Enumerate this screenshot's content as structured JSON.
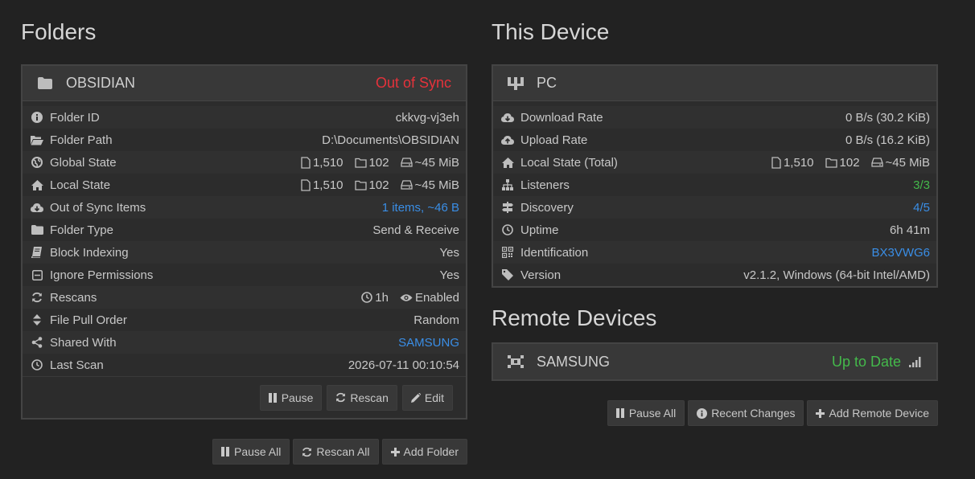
{
  "folders": {
    "heading": "Folders",
    "folder": {
      "name": "OBSIDIAN",
      "status": "Out of Sync",
      "rows": [
        {
          "icon": "info-icon",
          "label": "Folder ID",
          "value": "ckkvg-vj3eh"
        },
        {
          "icon": "folder-open-icon",
          "label": "Folder Path",
          "value": "D:\\Documents\\OBSIDIAN"
        },
        {
          "icon": "globe-icon",
          "label": "Global State",
          "files": "1,510",
          "dirs": "102",
          "size": "~45 MiB"
        },
        {
          "icon": "home-icon",
          "label": "Local State",
          "files": "1,510",
          "dirs": "102",
          "size": "~45 MiB"
        },
        {
          "icon": "cloud-download-icon",
          "label": "Out of Sync Items",
          "value": "1 items, ~46 B"
        },
        {
          "icon": "folder-icon",
          "label": "Folder Type",
          "value": "Send & Receive"
        },
        {
          "icon": "book-icon",
          "label": "Block Indexing",
          "value": "Yes"
        },
        {
          "icon": "square-icon",
          "label": "Ignore Permissions",
          "value": "Yes"
        },
        {
          "icon": "refresh-icon",
          "label": "Rescans",
          "interval": "1h",
          "watcher": "Enabled"
        },
        {
          "icon": "sort-icon",
          "label": "File Pull Order",
          "value": "Random"
        },
        {
          "icon": "share-icon",
          "label": "Shared With",
          "value": "SAMSUNG"
        },
        {
          "icon": "clock-icon",
          "label": "Last Scan",
          "value": "2026-07-11 00:10:54"
        }
      ],
      "buttons": {
        "pause": "Pause",
        "rescan": "Rescan",
        "edit": "Edit"
      }
    },
    "buttons": {
      "pause_all": "Pause All",
      "rescan_all": "Rescan All",
      "add_folder": "Add Folder"
    }
  },
  "this_device": {
    "heading": "This Device",
    "name": "PC",
    "rows": [
      {
        "icon": "cloud-download-icon",
        "label": "Download Rate",
        "value": "0 B/s (30.2 KiB)"
      },
      {
        "icon": "cloud-upload-icon",
        "label": "Upload Rate",
        "value": "0 B/s (16.2 KiB)"
      },
      {
        "icon": "home-icon",
        "label": "Local State (Total)",
        "files": "1,510",
        "dirs": "102",
        "size": "~45 MiB"
      },
      {
        "icon": "sitemap-icon",
        "label": "Listeners",
        "value": "3/3"
      },
      {
        "icon": "signpost-icon",
        "label": "Discovery",
        "value": "4/5"
      },
      {
        "icon": "clock-icon",
        "label": "Uptime",
        "value": "6h 41m"
      },
      {
        "icon": "qrcode-icon",
        "label": "Identification",
        "value": "BX3VWG6"
      },
      {
        "icon": "tag-icon",
        "label": "Version",
        "value": "v2.1.2, Windows (64-bit Intel/AMD)"
      }
    ]
  },
  "remote_devices": {
    "heading": "Remote Devices",
    "device": {
      "name": "SAMSUNG",
      "status": "Up to Date"
    },
    "buttons": {
      "pause_all": "Pause All",
      "recent_changes": "Recent Changes",
      "add_remote": "Add Remote Device"
    }
  },
  "colors": {
    "accent_blue": "#3a8ee6",
    "status_green": "#44b94b",
    "status_red": "#e5323b"
  }
}
